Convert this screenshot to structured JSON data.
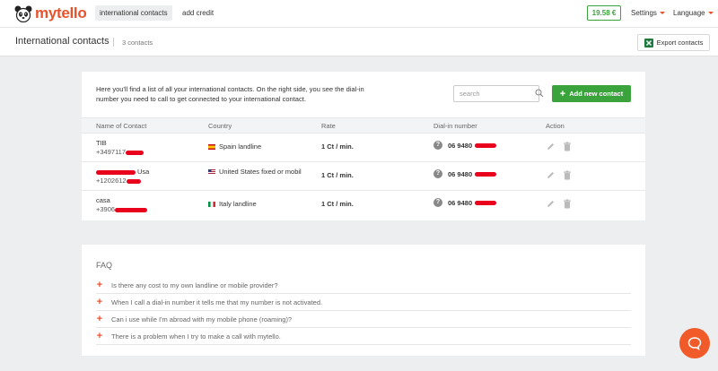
{
  "nav": {
    "brand": "mytello",
    "links": [
      {
        "label": "international contacts",
        "active": true
      },
      {
        "label": "add credit",
        "active": false
      }
    ],
    "balance": "19.58 €",
    "settings": "Settings",
    "language": "Language"
  },
  "subheader": {
    "title": "International contacts",
    "count": "3 contacts",
    "export": "Export contacts"
  },
  "main": {
    "intro": "Here you'll find a list of all your international contacts. On the right side, you see the dial-in number you need to call to get connected to your international contact.",
    "search_placeholder": "search",
    "add_button": "Add new contact"
  },
  "table": {
    "headers": [
      "Name of Contact",
      "Country",
      "Rate",
      "Dial-in number",
      "Action"
    ],
    "rows": [
      {
        "name": "TIB",
        "phone": "+3497117",
        "country": "Spain landline",
        "rate": "1 Ct / min.",
        "dialin": "06 9480"
      },
      {
        "name": "Usa",
        "phone": "+1202612",
        "country": "United States fixed or mobil",
        "rate": "1 Ct / min.",
        "dialin": "06 9480"
      },
      {
        "name": "casa",
        "phone": "+3906",
        "country": "Italy landline",
        "rate": "1 Ct / min.",
        "dialin": "06 9480"
      }
    ]
  },
  "faq": {
    "title": "FAQ",
    "items": [
      "Is there any cost to my own landline or mobile provider?",
      "When I call a dial-in number it tells me that my number is not activated.",
      "Can i use while I'm abroad with my mobile phone (roaming)?",
      "There is a problem when I try to make a call with mytello."
    ]
  },
  "colors": {
    "brand": "#e9522b",
    "accent_green": "#3ba33b",
    "redaction": "#e8001c"
  }
}
